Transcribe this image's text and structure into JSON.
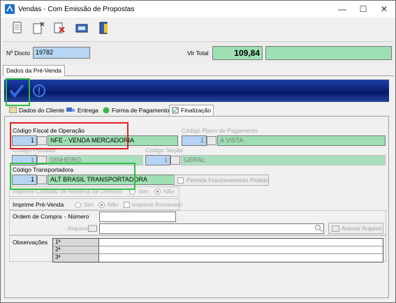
{
  "window": {
    "title": "Vendas - Com Emissão de Propostas",
    "buttons": {
      "minimize": "—",
      "maximize": "☐",
      "close": "✕"
    }
  },
  "header": {
    "docto_label": "Nº Docto",
    "docto_value": "19782",
    "vlr_total_label": "Vlr Total",
    "vlr_total_value": "109,84",
    "extra_value": ""
  },
  "main_tab": {
    "label": "Dados da Pré-Venda"
  },
  "subtabs": [
    {
      "label": "Dados do Cliente"
    },
    {
      "label": "Entrega"
    },
    {
      "label": "Forma de Pagamento"
    },
    {
      "label": "Finalização"
    }
  ],
  "form": {
    "cfop": {
      "label": "Código Fiscal de Operação",
      "code": "1",
      "value": "NFE - VENDA MERCADORIA"
    },
    "plano": {
      "label": "Código Plano de Pagamento",
      "code": "1",
      "value": "A VISTA"
    },
    "portador": {
      "label": "Código Portador",
      "code": "1",
      "value": "DINHEIRO"
    },
    "secao": {
      "label": "Código Seção",
      "code": "1",
      "value": "GERAL"
    },
    "transportadora": {
      "label": "Código Transportadora",
      "code": "1",
      "value": "ALT BRASIL TRANSPORTADORA"
    },
    "fracionamento": {
      "label": "Permite Fracionamento Pedido"
    },
    "contrato": {
      "label": "Imprime Contrato de Reserva de Domínio",
      "sim": "Sim",
      "nao": "Não"
    },
    "imprime_pv": {
      "label": "Imprime Pré-Venda",
      "sim": "Sim",
      "nao": "Não",
      "romaneio": "Imprime Romaneio"
    },
    "ordem": {
      "label": "Ordem de Compra",
      "numero_label": "- Número",
      "arquivo_label": "- Arquivo",
      "numero_value": "",
      "arquivo_value": "",
      "anexar_label": "Anexar Arquivo"
    },
    "observacoes": {
      "label": "Observações",
      "rows": [
        "1ª",
        "2ª",
        "3ª"
      ]
    }
  },
  "colors": {
    "banner": "#0b2377",
    "green_field": "#9ee0b4",
    "blue_field": "#b6d4f3",
    "highlight_red": "#e02020",
    "highlight_green": "#2fbf3f"
  }
}
